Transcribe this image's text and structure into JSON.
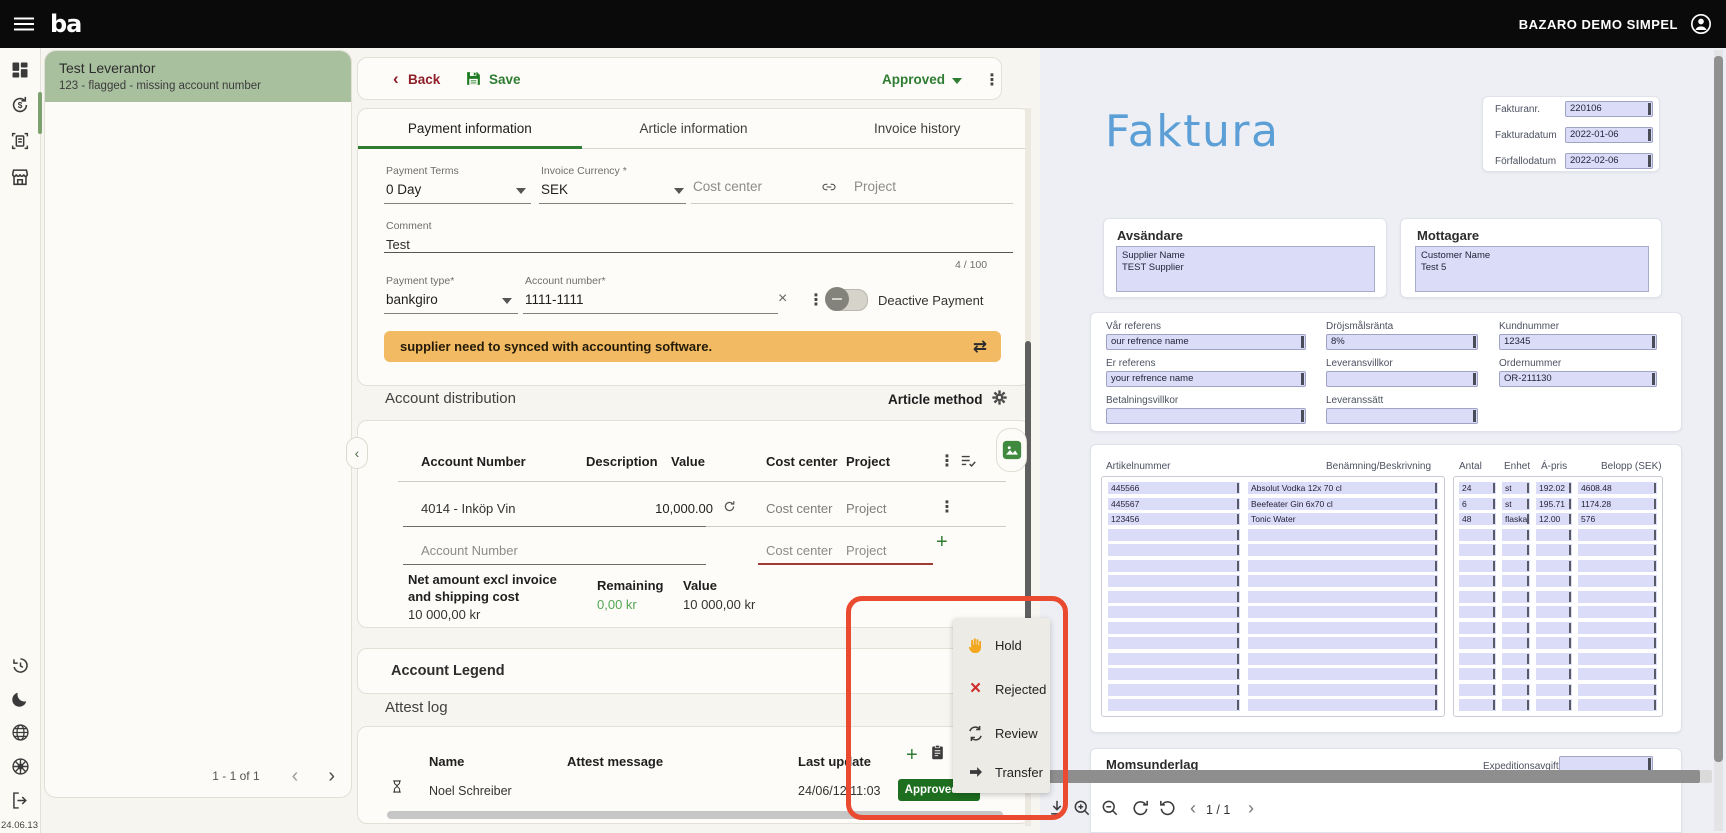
{
  "topbar": {
    "brand": "ba",
    "account": "BAZARO DEMO SIMPEL"
  },
  "rail": {
    "version": "24.06.13"
  },
  "suppliers": {
    "selected_title": "Test Leverantor",
    "selected_subtitle": "123 - flagged - missing account number",
    "pagination": "1 - 1 of 1"
  },
  "editor": {
    "back": "Back",
    "save": "Save",
    "status": "Approved",
    "tabs": [
      "Payment information",
      "Article information",
      "Invoice history"
    ],
    "payment_terms": {
      "label": "Payment Terms",
      "value": "0 Day"
    },
    "invoice_currency": {
      "label": "Invoice Currency *",
      "value": "SEK"
    },
    "cost_center": "Cost center",
    "project": "Project",
    "comment": {
      "label": "Comment",
      "value": "Test",
      "counter": "4 / 100"
    },
    "payment_type": {
      "label": "Payment type*",
      "value": "bankgiro"
    },
    "account_number": {
      "label": "Account number*",
      "value": "1111-1111"
    },
    "deactivate": "Deactive Payment",
    "warning": "supplier need to synced with accounting software.",
    "distribution": {
      "title": "Account distribution",
      "method": "Article method",
      "col_account": "Account Number",
      "col_description": "Description",
      "col_value": "Value",
      "col_cost": "Cost center",
      "col_project": "Project",
      "row": {
        "account": "4014 - Inköp Vin",
        "value": "10,000.00",
        "cost": "Cost center",
        "project": "Project"
      },
      "new_row": {
        "account": "Account Number",
        "cost": "Cost center",
        "project": "Project"
      },
      "net_label": "Net amount excl invoice and shipping cost",
      "net_value": "10 000,00 kr",
      "remaining_label": "Remaining",
      "remaining_value": "0,00 kr",
      "value_label": "Value",
      "value_value": "10 000,00 kr"
    },
    "legend_title": "Account Legend",
    "attest": {
      "title": "Attest log",
      "col_name": "Name",
      "col_message": "Attest message",
      "col_update": "Last update",
      "row": {
        "name": "Noel Schreiber",
        "updated": "24/06/12 11:03",
        "status": "Approved"
      }
    }
  },
  "menu": {
    "hold": "Hold",
    "rejected": "Rejected",
    "review": "Review",
    "transfer": "Transfer"
  },
  "pdf": {
    "title": "Faktura",
    "meta": [
      {
        "label": "Fakturanr.",
        "value": "220106"
      },
      {
        "label": "Fakturadatum",
        "value": "2022-01-06"
      },
      {
        "label": "Förfallodatum",
        "value": "2022-02-06"
      }
    ],
    "sender_label": "Avsändare",
    "sender_line1": "Supplier Name",
    "sender_line2": "TEST Supplier",
    "receiver_label": "Mottagare",
    "receiver_line1": "Customer Name",
    "receiver_line2": "Test 5",
    "refs": [
      {
        "label": "Vår referens",
        "value": "our refrence name"
      },
      {
        "label": "Dröjsmålsränta",
        "value": "8%"
      },
      {
        "label": "Kundnummer",
        "value": "12345"
      },
      {
        "label": "Er referens",
        "value": "your refrence name"
      },
      {
        "label": "Leveransvillkor",
        "value": ""
      },
      {
        "label": "Ordernummer",
        "value": "OR-211130"
      },
      {
        "label": "Betalningsvillkor",
        "value": ""
      },
      {
        "label": "Leveranssätt",
        "value": ""
      }
    ],
    "articles": {
      "col_no": "Artikelnummer",
      "col_desc": "Benämning/Beskrivning",
      "col_qty": "Antal",
      "col_unit": "Enhet",
      "col_price": "Á-pris",
      "col_amount": "Belopp (SEK)",
      "rows": [
        [
          "445566",
          "Absolut Vodka 12x 70 cl",
          "24",
          "st",
          "192.02",
          "4608.48"
        ],
        [
          "445567",
          "Beefeater Gin 6x70 cl",
          "6",
          "st",
          "195.71",
          "1174.28"
        ],
        [
          "123456",
          "Tonic Water",
          "48",
          "flaska",
          "12.00",
          "576"
        ]
      ]
    },
    "moms_title": "Momsunderlag",
    "expedition_label": "Expeditionsavgift",
    "pager": "1 / 1"
  },
  "icons": {
    "close": "×",
    "more_vertical": "⋮",
    "swap_horizontal": "⇄",
    "plus": "+",
    "chevron_left": "‹",
    "chevron_right": "›",
    "collapse_left": "‹",
    "back_chevron": "‹"
  },
  "colors": {
    "accent_green": "#2e7d32",
    "approved_button": "#1e6e20",
    "selected_sage": "#a9c09f",
    "warning_bg": "#f2ba62",
    "annotation_red": "#ea4a2f",
    "field_lavender": "#dbdcf7",
    "faktura_blue": "#5b9fd6",
    "back_red": "#8e1f28",
    "remaining_green": "#53a653"
  }
}
